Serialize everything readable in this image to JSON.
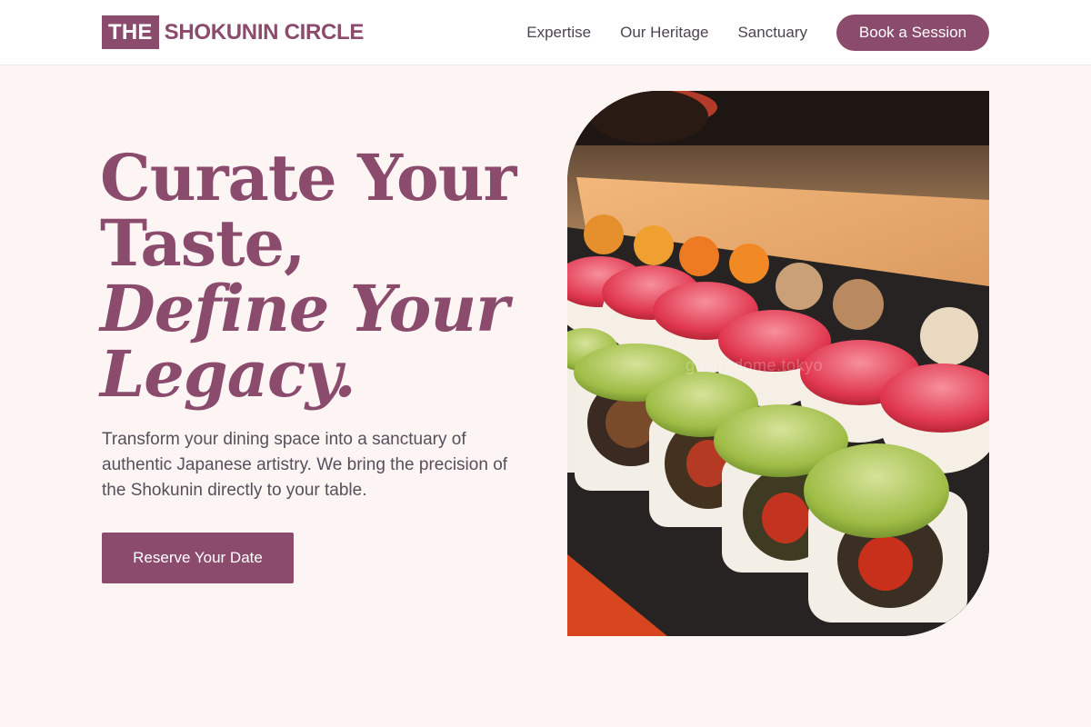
{
  "brand": {
    "badge": "THE",
    "name": "SHOKUNIN CIRCLE",
    "color": "#8b4b6c"
  },
  "nav": {
    "links": [
      {
        "label": "Expertise"
      },
      {
        "label": "Our Heritage"
      },
      {
        "label": "Sanctuary"
      }
    ],
    "cta_label": "Book a Session"
  },
  "hero": {
    "title_lines": [
      "Curate Your",
      "Taste,"
    ],
    "title_italic_lines": [
      "Define Your",
      "Legacy."
    ],
    "description": "Transform your dining space into a sanctuary of authentic Japanese artistry. We bring the precision of the Shokunin directly to your table.",
    "cta_label": "Reserve Your Date",
    "image": {
      "subject": "sushi-rolls-platter",
      "watermark": "gastrodome.tokyo"
    }
  },
  "colors": {
    "accent": "#8b4b6c",
    "page_background": "#fdf4f4",
    "header_background": "#ffffff",
    "body_text": "#55505a"
  }
}
